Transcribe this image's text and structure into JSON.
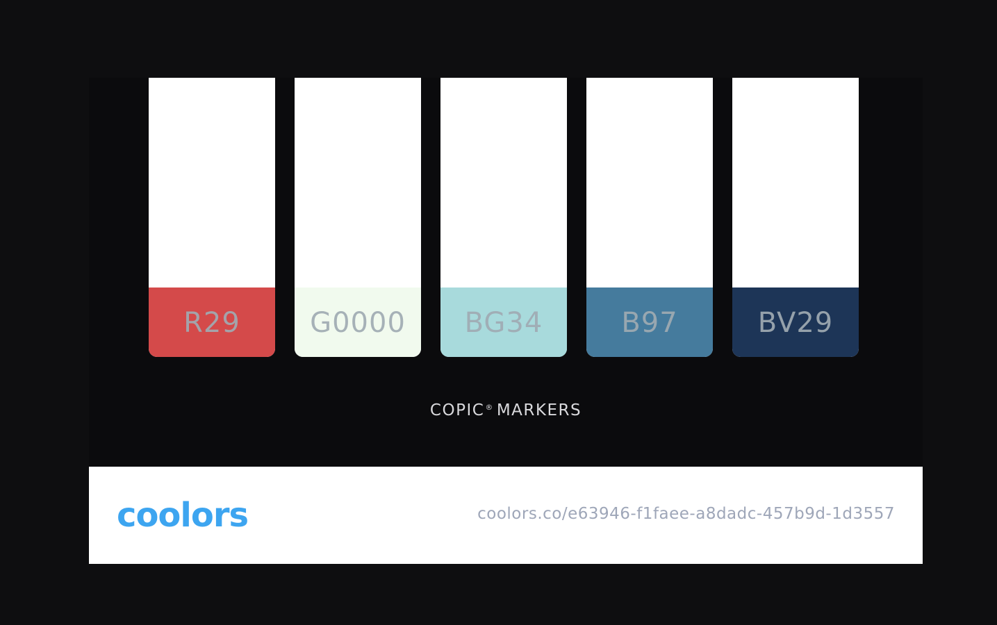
{
  "palette": {
    "swatches": [
      {
        "label": "R29",
        "color": "#d44a4a"
      },
      {
        "label": "G0000",
        "color": "#f1faee"
      },
      {
        "label": "BG34",
        "color": "#a8dadc"
      },
      {
        "label": "B97",
        "color": "#457b9d"
      },
      {
        "label": "BV29",
        "color": "#1d3557"
      }
    ],
    "caption": "COPIC",
    "caption_mark": "®",
    "caption_suffix": "MARKERS"
  },
  "footer": {
    "logo_text": "coolors",
    "url": "coolors.co/e63946-f1faee-a8dadc-457b9d-1d3557",
    "brand_color": "#3da5f0"
  }
}
